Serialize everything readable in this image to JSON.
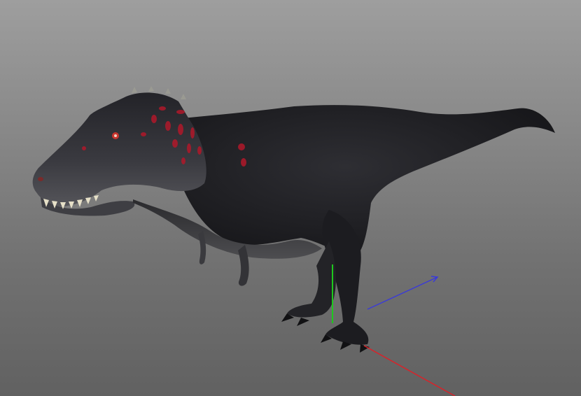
{
  "viewport": {
    "background_top": "#9e9e9e",
    "background_bottom": "#616161",
    "model": {
      "subject": "tyrannosaurus-rex",
      "body_color": "#1e1e22",
      "belly_color": "#4a4a4c",
      "marking_color": "#b0182a",
      "eye_color": "#c8342e",
      "teeth_color": "#e6e0c8"
    },
    "gizmo": {
      "x_axis_color": "#d8232a",
      "y_axis_color": "#1ec81e",
      "z_axis_color": "#3a3ad8"
    }
  }
}
